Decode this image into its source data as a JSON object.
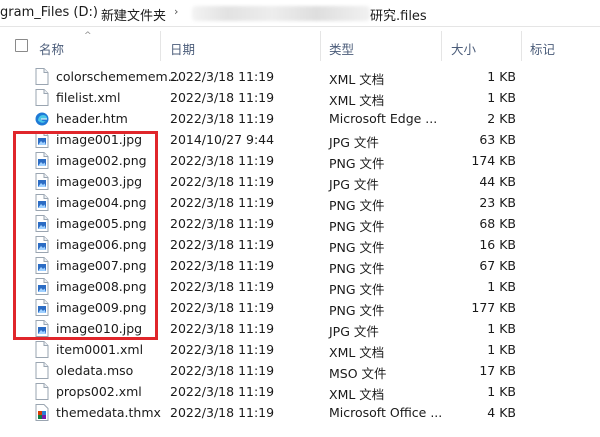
{
  "address": {
    "drive": "gram_Files (D:)",
    "folder": "新建文件夹",
    "current": "研究.files"
  },
  "columns": {
    "name": "名称",
    "date": "日期",
    "type": "类型",
    "size": "大小",
    "tags": "标记"
  },
  "files": [
    {
      "name": "colorschememem...",
      "date": "2022/3/18 11:19",
      "type": "XML 文档",
      "size": "1 KB",
      "icon": "document-icon"
    },
    {
      "name": "filelist.xml",
      "date": "2022/3/18 11:19",
      "type": "XML 文档",
      "size": "1 KB",
      "icon": "document-icon"
    },
    {
      "name": "header.htm",
      "date": "2022/3/18 11:19",
      "type": "Microsoft Edge ...",
      "size": "2 KB",
      "icon": "edge-icon"
    },
    {
      "name": "image001.jpg",
      "date": "2014/10/27 9:44",
      "type": "JPG 文件",
      "size": "63 KB",
      "icon": "image-icon"
    },
    {
      "name": "image002.png",
      "date": "2022/3/18 11:19",
      "type": "PNG 文件",
      "size": "174 KB",
      "icon": "image-icon"
    },
    {
      "name": "image003.jpg",
      "date": "2022/3/18 11:19",
      "type": "JPG 文件",
      "size": "44 KB",
      "icon": "image-icon"
    },
    {
      "name": "image004.png",
      "date": "2022/3/18 11:19",
      "type": "PNG 文件",
      "size": "23 KB",
      "icon": "image-icon"
    },
    {
      "name": "image005.png",
      "date": "2022/3/18 11:19",
      "type": "PNG 文件",
      "size": "68 KB",
      "icon": "image-icon"
    },
    {
      "name": "image006.png",
      "date": "2022/3/18 11:19",
      "type": "PNG 文件",
      "size": "16 KB",
      "icon": "image-icon"
    },
    {
      "name": "image007.png",
      "date": "2022/3/18 11:19",
      "type": "PNG 文件",
      "size": "67 KB",
      "icon": "image-icon"
    },
    {
      "name": "image008.png",
      "date": "2022/3/18 11:19",
      "type": "PNG 文件",
      "size": "1 KB",
      "icon": "image-icon"
    },
    {
      "name": "image009.png",
      "date": "2022/3/18 11:19",
      "type": "PNG 文件",
      "size": "177 KB",
      "icon": "image-icon"
    },
    {
      "name": "image010.jpg",
      "date": "2022/3/18 11:19",
      "type": "JPG 文件",
      "size": "1 KB",
      "icon": "image-icon"
    },
    {
      "name": "item0001.xml",
      "date": "2022/3/18 11:19",
      "type": "XML 文档",
      "size": "1 KB",
      "icon": "document-icon"
    },
    {
      "name": "oledata.mso",
      "date": "2022/3/18 11:19",
      "type": "MSO 文件",
      "size": "17 KB",
      "icon": "document-icon"
    },
    {
      "name": "props002.xml",
      "date": "2022/3/18 11:19",
      "type": "XML 文档",
      "size": "1 KB",
      "icon": "document-icon"
    },
    {
      "name": "themedata.thmx",
      "date": "2022/3/18 11:19",
      "type": "Microsoft Office ...",
      "size": "4 KB",
      "icon": "office-theme-icon"
    }
  ],
  "colors": {
    "header_text": "#4c5d7a",
    "highlight": "#e0262b",
    "edge_blue": "#1f7ad6",
    "image_blue": "#2b6cc4"
  }
}
